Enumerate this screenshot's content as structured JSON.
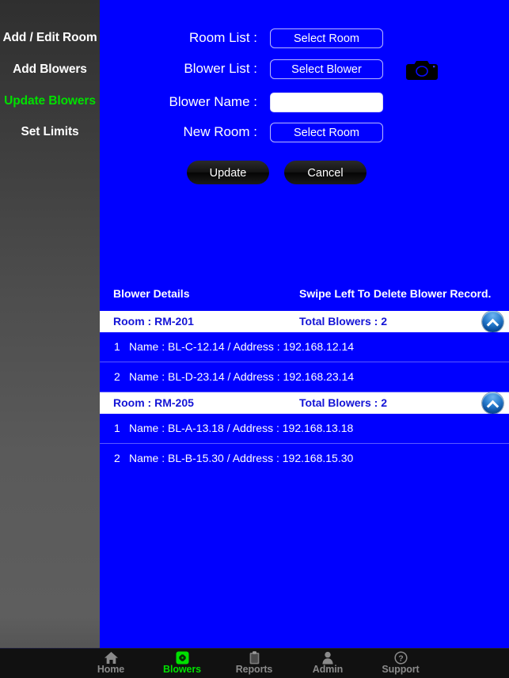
{
  "sidebar": {
    "items": [
      {
        "label": "Add / Edit Room",
        "active": false
      },
      {
        "label": "Add Blowers",
        "active": false
      },
      {
        "label": "Update Blowers",
        "active": true
      },
      {
        "label": "Set Limits",
        "active": false
      }
    ],
    "active_color": "#00e000"
  },
  "form": {
    "rows": [
      {
        "label": "Room List :",
        "control": "select",
        "value": "Select Room"
      },
      {
        "label": "Blower List :",
        "control": "select",
        "value": "Select Blower"
      },
      {
        "label": "Blower Name :",
        "control": "text",
        "value": "",
        "placeholder": ""
      },
      {
        "label": "New Room :",
        "control": "select",
        "value": "Select Room"
      }
    ],
    "camera_icon": "camera-icon",
    "update_label": "Update",
    "cancel_label": "Cancel"
  },
  "list": {
    "header_left": "Blower Details",
    "header_right": "Swipe Left To Delete Blower Record.",
    "rooms": [
      {
        "room_label": "Room : RM-201",
        "total_label": "Total Blowers : 2",
        "collapse_icon": "chevron-up-icon",
        "blowers": [
          {
            "index": "1",
            "text": "Name : BL-C-12.14  /  Address : 192.168.12.14"
          },
          {
            "index": "2",
            "text": "Name : BL-D-23.14  /  Address : 192.168.23.14"
          }
        ]
      },
      {
        "room_label": "Room : RM-205",
        "total_label": "Total Blowers : 2",
        "collapse_icon": "chevron-up-icon",
        "blowers": [
          {
            "index": "1",
            "text": "Name : BL-A-13.18  /  Address : 192.168.13.18"
          },
          {
            "index": "2",
            "text": "Name : BL-B-15.30  /  Address : 192.168.15.30"
          }
        ]
      }
    ]
  },
  "tabbar": {
    "tabs": [
      {
        "label": "Home",
        "icon": "home-icon",
        "active": false
      },
      {
        "label": "Blowers",
        "icon": "blower-grid-icon",
        "active": true
      },
      {
        "label": "Reports",
        "icon": "clipboard-icon",
        "active": false
      },
      {
        "label": "Admin",
        "icon": "person-icon",
        "active": false
      },
      {
        "label": "Support",
        "icon": "question-circle-icon",
        "active": false
      }
    ]
  },
  "colors": {
    "background_blue": "#0000ff",
    "sidebar_gray": "#4d4d4d",
    "accent_green": "#00e000",
    "room_header_white": "#ffffff",
    "room_header_text": "#1414d6",
    "tabbar_black": "#111111"
  }
}
